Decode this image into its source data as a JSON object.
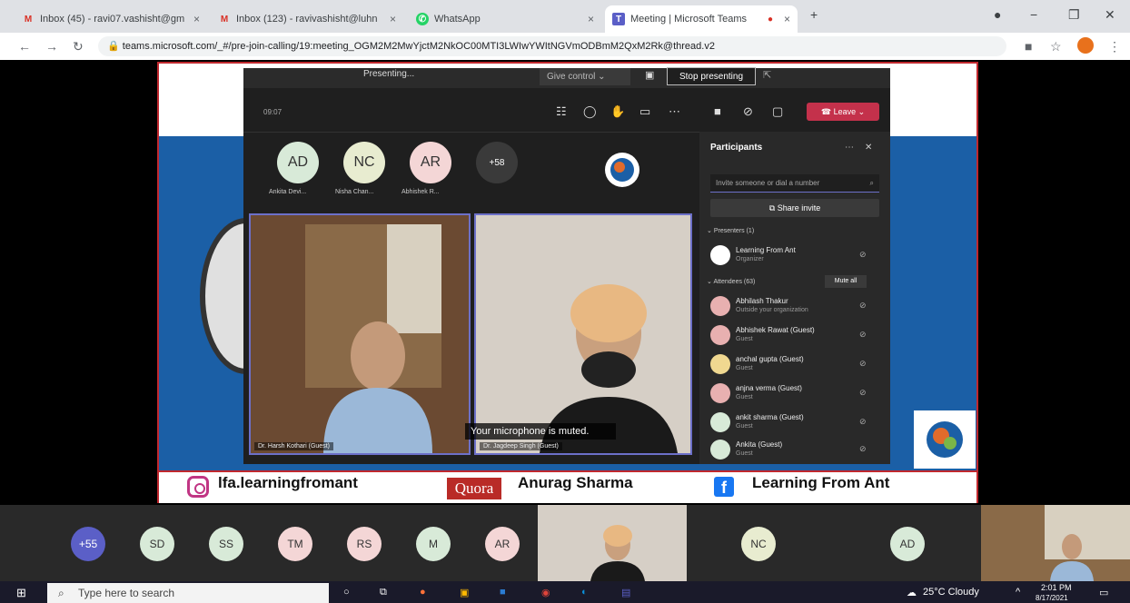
{
  "browser": {
    "tabs": [
      {
        "icon": "gmail-icon",
        "title": "Inbox (45) - ravi07.vashisht@gm",
        "close": "×"
      },
      {
        "icon": "gmail-icon",
        "title": "Inbox (123) - ravivashisht@luhn",
        "close": "×"
      },
      {
        "icon": "whatsapp-icon",
        "title": "WhatsApp",
        "close": "×"
      },
      {
        "icon": "teams-icon",
        "title": "Meeting | Microsoft Teams",
        "close": "×"
      }
    ],
    "new_tab": "+",
    "url": "teams.microsoft.com/_#/pre-join-calling/19:meeting_OGM2M2MwYjctM2NkOC00MTI3LWIwYWItNGVmODBmM2QxM2Rk@thread.v2"
  },
  "slide": {
    "instagram": "lfa.learningfromant",
    "quora_badge": "Quora",
    "quora_name": "Anurag Sharma",
    "facebook_badge": "f",
    "facebook_name": "Learning From Ant"
  },
  "teams": {
    "presenting": "Presenting...",
    "give_control": "Give control",
    "stop_presenting": "Stop presenting",
    "timer": "09:07",
    "leave": "Leave",
    "gallery": [
      {
        "initials": "AD",
        "name": "Ankita Devi...",
        "color": "#d8ead8"
      },
      {
        "initials": "NC",
        "name": "Nisha Chan...",
        "color": "#e8ecd0"
      },
      {
        "initials": "AR",
        "name": "Abhishek R...",
        "color": "#f4d6d6"
      }
    ],
    "overflow": "+58",
    "video1_label": "Dr. Harsh Kothari (Guest)",
    "video2_label": "Dr. Jagdeep Singh (Guest)",
    "muted_toast": "Your microphone is muted.",
    "participants": {
      "title": "Participants",
      "invite_placeholder": "Invite someone or dial a number",
      "share_invite": "Share invite",
      "presenters_header": "Presenters (1)",
      "attendees_header": "Attendees (63)",
      "mute_all": "Mute all",
      "presenters": [
        {
          "name": "Learning From Ant",
          "role": "Organizer"
        }
      ],
      "attendees": [
        {
          "name": "Abhilash Thakur",
          "role": "Outside your organization"
        },
        {
          "name": "Abhishek Rawat (Guest)",
          "role": "Guest"
        },
        {
          "name": "anchal gupta (Guest)",
          "role": "Guest"
        },
        {
          "name": "anjna verma (Guest)",
          "role": "Guest"
        },
        {
          "name": "ankit sharma (Guest)",
          "role": "Guest"
        },
        {
          "name": "Ankita (Guest)",
          "role": "Guest"
        }
      ]
    }
  },
  "strip": {
    "avatars": [
      {
        "initials": "+55",
        "color": "#5b5fc7"
      },
      {
        "initials": "SD",
        "color": "#d8ead8"
      },
      {
        "initials": "SS",
        "color": "#d8ead8"
      },
      {
        "initials": "TM",
        "color": "#f4d6d6"
      },
      {
        "initials": "RS",
        "color": "#f4d6d6"
      },
      {
        "initials": "M",
        "color": "#d8ead8"
      },
      {
        "initials": "AR",
        "color": "#f4d6d6"
      },
      {
        "initials": "NC",
        "color": "#e8ecd0"
      },
      {
        "initials": "AD",
        "color": "#d8ead8"
      }
    ]
  },
  "taskbar": {
    "search_placeholder": "Type here to search",
    "weather": "25°C Cloudy",
    "time": "2:01 PM",
    "date": "8/17/2021"
  }
}
